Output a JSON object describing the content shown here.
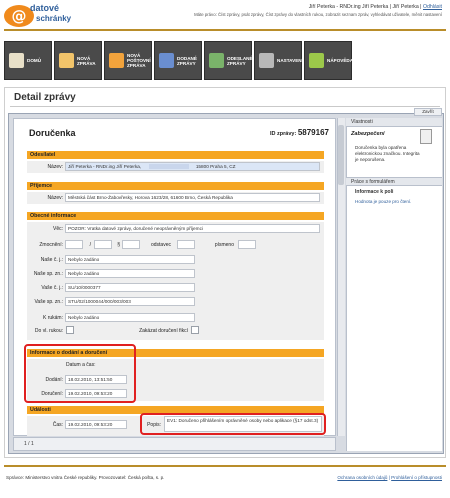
{
  "header": {
    "logo_symbol": "@",
    "logo_line1": "datové",
    "logo_line2": "schránky",
    "user_name": "Jiří Peterka - RNDr.ing Jiří Peterka",
    "user_sep": " | ",
    "user_name2": "Jiří Peterka",
    "logout": "Odhlásit",
    "hint": "Máte právo: Číst zprávy, psát zprávy, Číst zprávy do vlastních rukou, zobrazit seznam zpráv, vyhledávat uživatele, měnit nastavení"
  },
  "nav": [
    {
      "label": "DOMŮ",
      "icon": "home-icon",
      "color": "#e8e0c8"
    },
    {
      "label": "NOVÁ ZPRÁVA",
      "icon": "new-message-icon",
      "color": "#f2c46a"
    },
    {
      "label": "NOVÁ POŠTOVNÍ ZPRÁVA",
      "icon": "new-postal-message-icon",
      "color": "#f2a33c"
    },
    {
      "label": "DODANÉ ZPRÁVY",
      "icon": "received-messages-icon",
      "color": "#6a8ed0"
    },
    {
      "label": "ODESLANÉ ZPRÁVY",
      "icon": "sent-messages-icon",
      "color": "#7ab36a"
    },
    {
      "label": "NASTAVENÍ",
      "icon": "gears-icon",
      "color": "#b8b8b8"
    },
    {
      "label": "NÁPOVĚDA",
      "icon": "help-icon",
      "color": "#9cc84a"
    }
  ],
  "page_title": "Detail zprávy",
  "doc": {
    "title": "Doručenka",
    "id_label": "ID zprávy:",
    "id_value": "5879167",
    "sec_sender": "Odesílatel",
    "sender_label": "Název:",
    "sender_value": "Jiří Peterka - RNDr.ing Jiří Peterka,",
    "sender_addr": "15800 Praha 5, CZ",
    "sec_recipient": "Příjemce",
    "recipient_label": "Název:",
    "recipient_value": "Městská část Brno-Žabovřesky, Horova 1623/28, 61600 Brno, Česká Republika",
    "sec_general": "Obecné informace",
    "vec_label": "Věc:",
    "vec_value": "POZOR: Vratka datové zprávy, doručené neoprávněným příjemci",
    "zmocneni_label": "Zmocnění:",
    "slash": "/",
    "paragraph": "§",
    "odstavec": "odstavec",
    "pismeno": "písmeno",
    "nase_cj_label": "Naše č. j.:",
    "nase_cj_value": "Nebylo zadáno",
    "nase_sz_label": "Naše sp. zn.:",
    "nase_sz_value": "Nebylo zadáno",
    "vase_cj_label": "Vaše č. j.:",
    "vase_cj_value": "SU/10/0000377",
    "vase_sz_label": "Vaše sp. zn.:",
    "vase_sz_value": "STU/02/1000044/000/003/003",
    "k_rukam_label": "K rukám:",
    "k_rukam_value": "Nebylo zadáno",
    "do_vl_label": "Do vl. rukou:",
    "zakazat_label": "Zakázat doručení fikcí",
    "sec_delivery": "Informace o dodání a doručení",
    "datum_label": "Datum a čas:",
    "dodani_label": "Dodání:",
    "dodani_value": "18.02.2010, 13:51:50",
    "doruceni_label": "Doručení:",
    "doruceni_value": "19.02.2010, 09:53:20",
    "sec_events": "Události",
    "cas_label": "Čas:",
    "cas_value": "19.02.2010, 09:53:20",
    "popis_label": "Popis:",
    "popis_value": "EV1: Doručeno přihlášením oprávněné osoby nebo aplikace (§17 odst.3)"
  },
  "statusbar": {
    "page": "1 / 1"
  },
  "right": {
    "close": "Zavřít",
    "pane_title": "Vlastnosti",
    "zab_title": "Zabezpečení",
    "zab_text": "Doručenka byla opatřena elektronickou značkou. Integrita je neporušena.",
    "form_title": "Práce s formulářem",
    "info_title": "Informace k poli",
    "info_text": "Hodnota je pouze pro čtení."
  },
  "footer": {
    "left": "Správce: Ministerstvo vnitra České republiky. Provozovatel: Česká pošta, s. p.",
    "right1": "Ochrana osobních údajů",
    "right_sep": " | ",
    "right2": "Prohlášení o přístupnosti"
  }
}
